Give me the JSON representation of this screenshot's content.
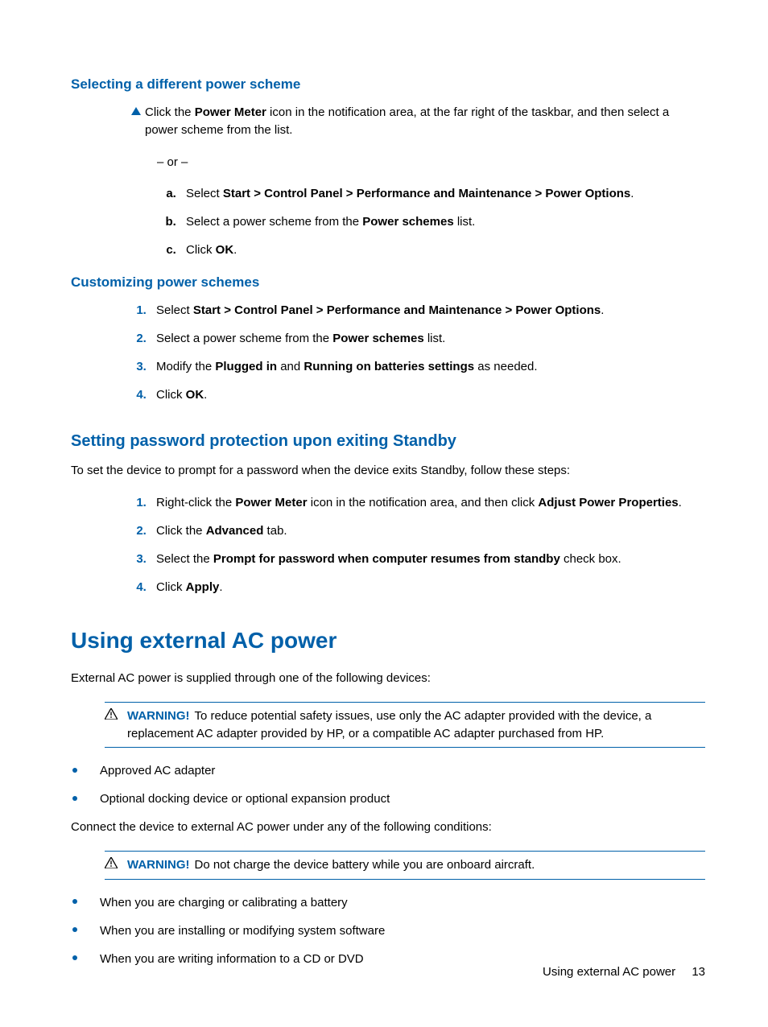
{
  "section1": {
    "heading": "Selecting a different power scheme",
    "note_pre": "Click the ",
    "note_bold": "Power Meter",
    "note_post": " icon in the notification area, at the far right of the taskbar, and then select a power scheme from the list.",
    "or": "– or –",
    "steps": {
      "a_pre": "Select ",
      "a_bold": "Start > Control Panel > Performance and Maintenance > Power Options",
      "a_post": ".",
      "b_pre": "Select a power scheme from the ",
      "b_bold": "Power schemes",
      "b_post": " list.",
      "c_pre": "Click ",
      "c_bold": "OK",
      "c_post": "."
    }
  },
  "section2": {
    "heading": "Customizing power schemes",
    "steps": {
      "s1_pre": "Select ",
      "s1_bold": "Start > Control Panel > Performance and Maintenance > Power Options",
      "s1_post": ".",
      "s2_pre": "Select a power scheme from the ",
      "s2_bold": "Power schemes",
      "s2_post": " list.",
      "s3_pre": "Modify the ",
      "s3_b1": "Plugged in",
      "s3_mid": " and ",
      "s3_b2": "Running on batteries settings",
      "s3_post": " as needed.",
      "s4_pre": "Click ",
      "s4_bold": "OK",
      "s4_post": "."
    }
  },
  "section3": {
    "heading": "Setting password protection upon exiting Standby",
    "intro": "To set the device to prompt for a password when the device exits Standby, follow these steps:",
    "steps": {
      "s1_pre": "Right-click the ",
      "s1_b1": "Power Meter",
      "s1_mid": " icon in the notification area, and then click ",
      "s1_b2": "Adjust Power Properties",
      "s1_post": ".",
      "s2_pre": "Click the ",
      "s2_bold": "Advanced",
      "s2_post": " tab.",
      "s3_pre": "Select the ",
      "s3_bold": "Prompt for password when computer resumes from standby",
      "s3_post": " check box.",
      "s4_pre": "Click ",
      "s4_bold": "Apply",
      "s4_post": "."
    }
  },
  "section4": {
    "heading": "Using external AC power",
    "intro": "External AC power is supplied through one of the following devices:",
    "warn1_label": "WARNING!",
    "warn1_body": "To reduce potential safety issues, use only the AC adapter provided with the device, a replacement AC adapter provided by HP, or a compatible AC adapter purchased from HP.",
    "list1": {
      "i1": "Approved AC adapter",
      "i2": "Optional docking device or optional expansion product"
    },
    "mid": "Connect the device to external AC power under any of the following conditions:",
    "warn2_label": "WARNING!",
    "warn2_body": "Do not charge the device battery while you are onboard aircraft.",
    "list2": {
      "i1": "When you are charging or calibrating a battery",
      "i2": "When you are installing or modifying system software",
      "i3": "When you are writing information to a CD or DVD"
    }
  },
  "footer": {
    "text": "Using external AC power",
    "page": "13"
  }
}
